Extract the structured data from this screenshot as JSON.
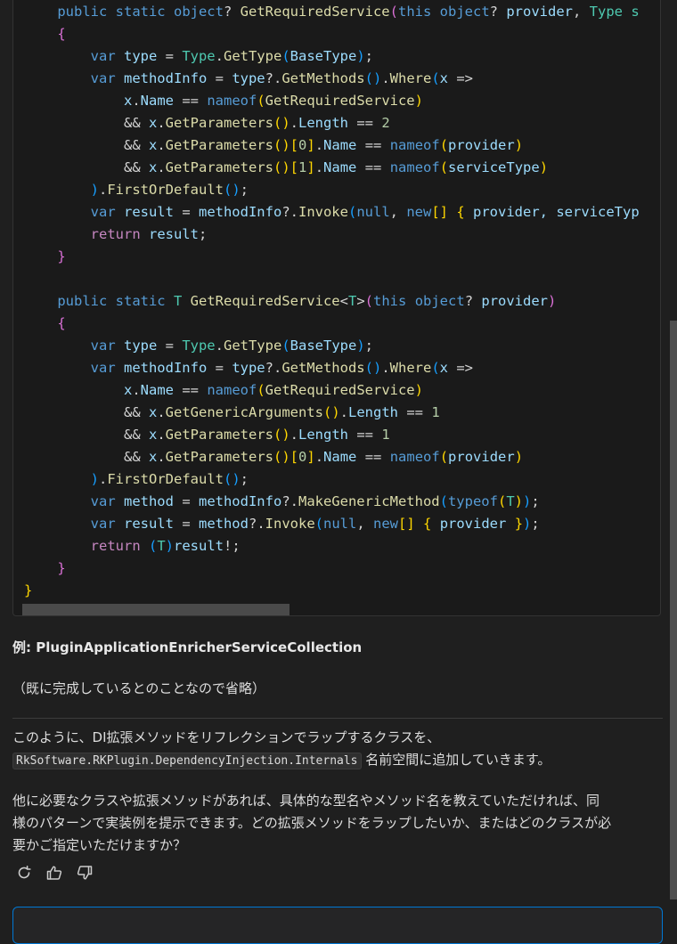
{
  "code": {
    "lines": [
      [
        [
          "    ",
          ""
        ],
        [
          "public static ",
          "k"
        ],
        [
          "object",
          "k"
        ],
        [
          "? ",
          ""
        ],
        [
          "GetRequiredService",
          "m"
        ],
        [
          "(",
          "b2"
        ],
        [
          "this ",
          "k"
        ],
        [
          "object",
          "k"
        ],
        [
          "? ",
          ""
        ],
        [
          "provider",
          "v"
        ],
        [
          ", ",
          ""
        ],
        [
          "Type s",
          "t"
        ]
      ],
      [
        [
          "    ",
          ""
        ],
        [
          "{",
          "b2"
        ]
      ],
      [
        [
          "        ",
          ""
        ],
        [
          "var ",
          "k"
        ],
        [
          "type",
          "v"
        ],
        [
          " = ",
          ""
        ],
        [
          "Type",
          "t"
        ],
        [
          ".",
          ""
        ],
        [
          "GetType",
          "m"
        ],
        [
          "(",
          "b3"
        ],
        [
          "BaseType",
          "v"
        ],
        [
          ")",
          "b3"
        ],
        [
          ";",
          ""
        ]
      ],
      [
        [
          "        ",
          ""
        ],
        [
          "var ",
          "k"
        ],
        [
          "methodInfo",
          "v"
        ],
        [
          " = ",
          ""
        ],
        [
          "type",
          "v"
        ],
        [
          "?.",
          ""
        ],
        [
          "GetMethods",
          "m"
        ],
        [
          "()",
          "b3"
        ],
        [
          ".",
          ""
        ],
        [
          "Where",
          "m"
        ],
        [
          "(",
          "b3"
        ],
        [
          "x",
          "v"
        ],
        [
          " =>",
          ""
        ]
      ],
      [
        [
          "            ",
          ""
        ],
        [
          "x",
          "v"
        ],
        [
          ".",
          ""
        ],
        [
          "Name",
          "v"
        ],
        [
          " == ",
          ""
        ],
        [
          "nameof",
          "k"
        ],
        [
          "(",
          "b1"
        ],
        [
          "GetRequiredService",
          "m"
        ],
        [
          ")",
          "b1"
        ]
      ],
      [
        [
          "            ",
          ""
        ],
        [
          "&& ",
          ""
        ],
        [
          "x",
          "v"
        ],
        [
          ".",
          ""
        ],
        [
          "GetParameters",
          "m"
        ],
        [
          "()",
          "b1"
        ],
        [
          ".",
          ""
        ],
        [
          "Length",
          "v"
        ],
        [
          " == ",
          ""
        ],
        [
          "2",
          "n"
        ]
      ],
      [
        [
          "            ",
          ""
        ],
        [
          "&& ",
          ""
        ],
        [
          "x",
          "v"
        ],
        [
          ".",
          ""
        ],
        [
          "GetParameters",
          "m"
        ],
        [
          "()",
          "b1"
        ],
        [
          "[",
          "b1"
        ],
        [
          "0",
          "n"
        ],
        [
          "]",
          "b1"
        ],
        [
          ".",
          ""
        ],
        [
          "Name",
          "v"
        ],
        [
          " == ",
          ""
        ],
        [
          "nameof",
          "k"
        ],
        [
          "(",
          "b1"
        ],
        [
          "provider",
          "v"
        ],
        [
          ")",
          "b1"
        ]
      ],
      [
        [
          "            ",
          ""
        ],
        [
          "&& ",
          ""
        ],
        [
          "x",
          "v"
        ],
        [
          ".",
          ""
        ],
        [
          "GetParameters",
          "m"
        ],
        [
          "()",
          "b1"
        ],
        [
          "[",
          "b1"
        ],
        [
          "1",
          "n"
        ],
        [
          "]",
          "b1"
        ],
        [
          ".",
          ""
        ],
        [
          "Name",
          "v"
        ],
        [
          " == ",
          ""
        ],
        [
          "nameof",
          "k"
        ],
        [
          "(",
          "b1"
        ],
        [
          "serviceType",
          "v"
        ],
        [
          ")",
          "b1"
        ]
      ],
      [
        [
          "        ",
          ""
        ],
        [
          ")",
          "b3"
        ],
        [
          ".",
          ""
        ],
        [
          "FirstOrDefault",
          "m"
        ],
        [
          "()",
          "b3"
        ],
        [
          ";",
          ""
        ]
      ],
      [
        [
          "        ",
          ""
        ],
        [
          "var ",
          "k"
        ],
        [
          "result",
          "v"
        ],
        [
          " = ",
          ""
        ],
        [
          "methodInfo",
          "v"
        ],
        [
          "?.",
          ""
        ],
        [
          "Invoke",
          "m"
        ],
        [
          "(",
          "b3"
        ],
        [
          "null",
          "k"
        ],
        [
          ", ",
          ""
        ],
        [
          "new",
          "k"
        ],
        [
          "[]",
          "b1"
        ],
        [
          " ",
          ""
        ],
        [
          "{",
          "b1"
        ],
        [
          " provider, serviceTyp",
          "v"
        ]
      ],
      [
        [
          "        ",
          ""
        ],
        [
          "return ",
          "cf"
        ],
        [
          "result",
          "v"
        ],
        [
          ";",
          ""
        ]
      ],
      [
        [
          "    ",
          ""
        ],
        [
          "}",
          "b2"
        ]
      ],
      [
        [
          "",
          ""
        ]
      ],
      [
        [
          "    ",
          ""
        ],
        [
          "public static ",
          "k"
        ],
        [
          "T ",
          "t"
        ],
        [
          "GetRequiredService",
          "m"
        ],
        [
          "<",
          ""
        ],
        [
          "T",
          "t"
        ],
        [
          ">",
          ""
        ],
        [
          "(",
          "b2"
        ],
        [
          "this ",
          "k"
        ],
        [
          "object",
          "k"
        ],
        [
          "? ",
          ""
        ],
        [
          "provider",
          "v"
        ],
        [
          ")",
          "b2"
        ]
      ],
      [
        [
          "    ",
          ""
        ],
        [
          "{",
          "b2"
        ]
      ],
      [
        [
          "        ",
          ""
        ],
        [
          "var ",
          "k"
        ],
        [
          "type",
          "v"
        ],
        [
          " = ",
          ""
        ],
        [
          "Type",
          "t"
        ],
        [
          ".",
          ""
        ],
        [
          "GetType",
          "m"
        ],
        [
          "(",
          "b3"
        ],
        [
          "BaseType",
          "v"
        ],
        [
          ")",
          "b3"
        ],
        [
          ";",
          ""
        ]
      ],
      [
        [
          "        ",
          ""
        ],
        [
          "var ",
          "k"
        ],
        [
          "methodInfo",
          "v"
        ],
        [
          " = ",
          ""
        ],
        [
          "type",
          "v"
        ],
        [
          "?.",
          ""
        ],
        [
          "GetMethods",
          "m"
        ],
        [
          "()",
          "b3"
        ],
        [
          ".",
          ""
        ],
        [
          "Where",
          "m"
        ],
        [
          "(",
          "b3"
        ],
        [
          "x",
          "v"
        ],
        [
          " =>",
          ""
        ]
      ],
      [
        [
          "            ",
          ""
        ],
        [
          "x",
          "v"
        ],
        [
          ".",
          ""
        ],
        [
          "Name",
          "v"
        ],
        [
          " == ",
          ""
        ],
        [
          "nameof",
          "k"
        ],
        [
          "(",
          "b1"
        ],
        [
          "GetRequiredService",
          "m"
        ],
        [
          ")",
          "b1"
        ]
      ],
      [
        [
          "            ",
          ""
        ],
        [
          "&& ",
          ""
        ],
        [
          "x",
          "v"
        ],
        [
          ".",
          ""
        ],
        [
          "GetGenericArguments",
          "m"
        ],
        [
          "()",
          "b1"
        ],
        [
          ".",
          ""
        ],
        [
          "Length",
          "v"
        ],
        [
          " == ",
          ""
        ],
        [
          "1",
          "n"
        ]
      ],
      [
        [
          "            ",
          ""
        ],
        [
          "&& ",
          ""
        ],
        [
          "x",
          "v"
        ],
        [
          ".",
          ""
        ],
        [
          "GetParameters",
          "m"
        ],
        [
          "()",
          "b1"
        ],
        [
          ".",
          ""
        ],
        [
          "Length",
          "v"
        ],
        [
          " == ",
          ""
        ],
        [
          "1",
          "n"
        ]
      ],
      [
        [
          "            ",
          ""
        ],
        [
          "&& ",
          ""
        ],
        [
          "x",
          "v"
        ],
        [
          ".",
          ""
        ],
        [
          "GetParameters",
          "m"
        ],
        [
          "()",
          "b1"
        ],
        [
          "[",
          "b1"
        ],
        [
          "0",
          "n"
        ],
        [
          "]",
          "b1"
        ],
        [
          ".",
          ""
        ],
        [
          "Name",
          "v"
        ],
        [
          " == ",
          ""
        ],
        [
          "nameof",
          "k"
        ],
        [
          "(",
          "b1"
        ],
        [
          "provider",
          "v"
        ],
        [
          ")",
          "b1"
        ]
      ],
      [
        [
          "        ",
          ""
        ],
        [
          ")",
          "b3"
        ],
        [
          ".",
          ""
        ],
        [
          "FirstOrDefault",
          "m"
        ],
        [
          "()",
          "b3"
        ],
        [
          ";",
          ""
        ]
      ],
      [
        [
          "        ",
          ""
        ],
        [
          "var ",
          "k"
        ],
        [
          "method",
          "v"
        ],
        [
          " = ",
          ""
        ],
        [
          "methodInfo",
          "v"
        ],
        [
          "?.",
          ""
        ],
        [
          "MakeGenericMethod",
          "m"
        ],
        [
          "(",
          "b3"
        ],
        [
          "typeof",
          "k"
        ],
        [
          "(",
          "b1"
        ],
        [
          "T",
          "t"
        ],
        [
          ")",
          "b1"
        ],
        [
          ")",
          "b3"
        ],
        [
          ";",
          ""
        ]
      ],
      [
        [
          "        ",
          ""
        ],
        [
          "var ",
          "k"
        ],
        [
          "result",
          "v"
        ],
        [
          " = ",
          ""
        ],
        [
          "method",
          "v"
        ],
        [
          "?.",
          ""
        ],
        [
          "Invoke",
          "m"
        ],
        [
          "(",
          "b3"
        ],
        [
          "null",
          "k"
        ],
        [
          ", ",
          ""
        ],
        [
          "new",
          "k"
        ],
        [
          "[]",
          "b1"
        ],
        [
          " ",
          ""
        ],
        [
          "{",
          "b1"
        ],
        [
          " provider ",
          "v"
        ],
        [
          "}",
          "b1"
        ],
        [
          ")",
          "b3"
        ],
        [
          ";",
          ""
        ]
      ],
      [
        [
          "        ",
          ""
        ],
        [
          "return ",
          "cf"
        ],
        [
          "(",
          "b3"
        ],
        [
          "T",
          "t"
        ],
        [
          ")",
          "b3"
        ],
        [
          "result",
          "v"
        ],
        [
          "!;",
          ""
        ]
      ],
      [
        [
          "    ",
          ""
        ],
        [
          "}",
          "b2"
        ]
      ],
      [
        [
          "}",
          "b1"
        ]
      ]
    ]
  },
  "example_title": "例: PluginApplicationEnricherServiceCollection",
  "omitted_note": "（既に完成しているとのことなので省略）",
  "summary": {
    "line1": "このように、DI拡張メソッドをリフレクションでラップするクラスを、",
    "namespace_code": "RkSoftware.RKPlugin.DependencyInjection.Internals",
    "line2_suffix": " 名前空間に追加していきます。"
  },
  "followup": {
    "line1": "他に必要なクラスや拡張メソッドがあれば、具体的な型名やメソッド名を教えていただければ、同",
    "line2": "様のパターンで実装例を提示できます。どの拡張メソッドをラップしたいか、またはどのクラスが必",
    "line3": "要かご指定いただけますか？"
  },
  "actions": [
    {
      "name": "retry-icon",
      "label": "retry"
    },
    {
      "name": "thumbs-up-icon",
      "label": "like"
    },
    {
      "name": "thumbs-down-icon",
      "label": "dislike"
    }
  ]
}
